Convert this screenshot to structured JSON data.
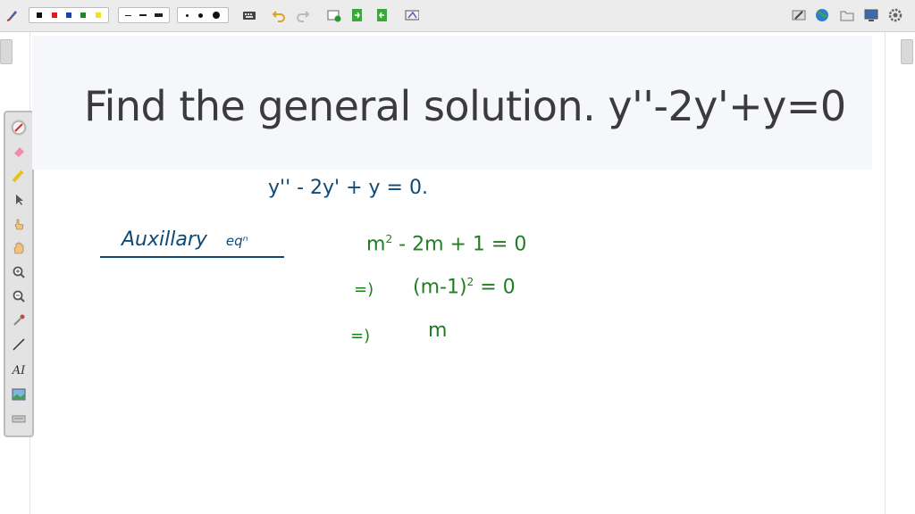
{
  "question": {
    "text": "Find the general solution. y''-2y'+y=0"
  },
  "handwritten": {
    "equation": "y'' - 2y' + y = 0.",
    "aux_word": "Auxillary",
    "aux_suffix": "eqⁿ",
    "line1_base": "m",
    "line1_exp": "2",
    "line1_rest": " - 2m + 1 = 0",
    "arrow": "=)",
    "line2_base": "(m-1)",
    "line2_exp": "2",
    "line2_rest": " = 0",
    "line3": "m"
  },
  "colors": {
    "ink_blue": "#0d4a78",
    "ink_green": "#1e7f1e",
    "toolbar_bg": "#ececec"
  },
  "toolbar": {
    "pen_colors": [
      "#111111",
      "#e21b1b",
      "#1d3fb3",
      "#1b8a2a",
      "#f2e21a"
    ],
    "icons": [
      "pen-settings-icon",
      "keyboard-icon",
      "undo-icon",
      "redo-icon",
      "add-page-icon",
      "export-icon",
      "import-icon",
      "record-icon",
      "edit-icon",
      "globe-icon",
      "folder-icon",
      "screen-icon",
      "settings-icon"
    ]
  },
  "tools": [
    "pen-icon",
    "eraser-icon",
    "highlighter-icon",
    "pointer-icon",
    "hand-pointer-icon",
    "hand-pan-icon",
    "zoom-in-icon",
    "zoom-out-icon",
    "color-picker-icon",
    "line-icon",
    "text-icon",
    "image-icon",
    "keyboard-tool-icon"
  ],
  "text_tool_label": "AI"
}
